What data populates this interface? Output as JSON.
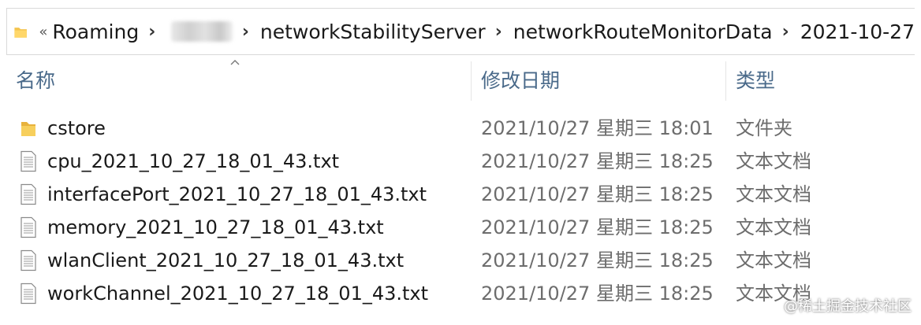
{
  "address_bar": {
    "path": [
      "Roaming",
      "",
      "networkStabilityServer",
      "networkRouteMonitorData",
      "2021-10-27"
    ],
    "overflow_glyph": "«",
    "separator": "›"
  },
  "columns": {
    "name": "名称",
    "date": "修改日期",
    "type": "类型"
  },
  "files": [
    {
      "name": "cstore",
      "date": "2021/10/27 星期三 18:01",
      "type": "文件夹",
      "icon": "folder-icon"
    },
    {
      "name": "cpu_2021_10_27_18_01_43.txt",
      "date": "2021/10/27 星期三 18:25",
      "type": "文本文档",
      "icon": "text-file-icon"
    },
    {
      "name": "interfacePort_2021_10_27_18_01_43.txt",
      "date": "2021/10/27 星期三 18:25",
      "type": "文本文档",
      "icon": "text-file-icon"
    },
    {
      "name": "memory_2021_10_27_18_01_43.txt",
      "date": "2021/10/27 星期三 18:25",
      "type": "文本文档",
      "icon": "text-file-icon"
    },
    {
      "name": "wlanClient_2021_10_27_18_01_43.txt",
      "date": "2021/10/27 星期三 18:25",
      "type": "文本文档",
      "icon": "text-file-icon"
    },
    {
      "name": "workChannel_2021_10_27_18_01_43.txt",
      "date": "2021/10/27 星期三 18:25",
      "type": "文本文档",
      "icon": "text-file-icon"
    }
  ],
  "watermark": "@稀土掘金技术社区",
  "colors": {
    "folder": "#f4c44e",
    "header_text": "#4a6a8a",
    "secondary_text": "#6d6d6d"
  }
}
